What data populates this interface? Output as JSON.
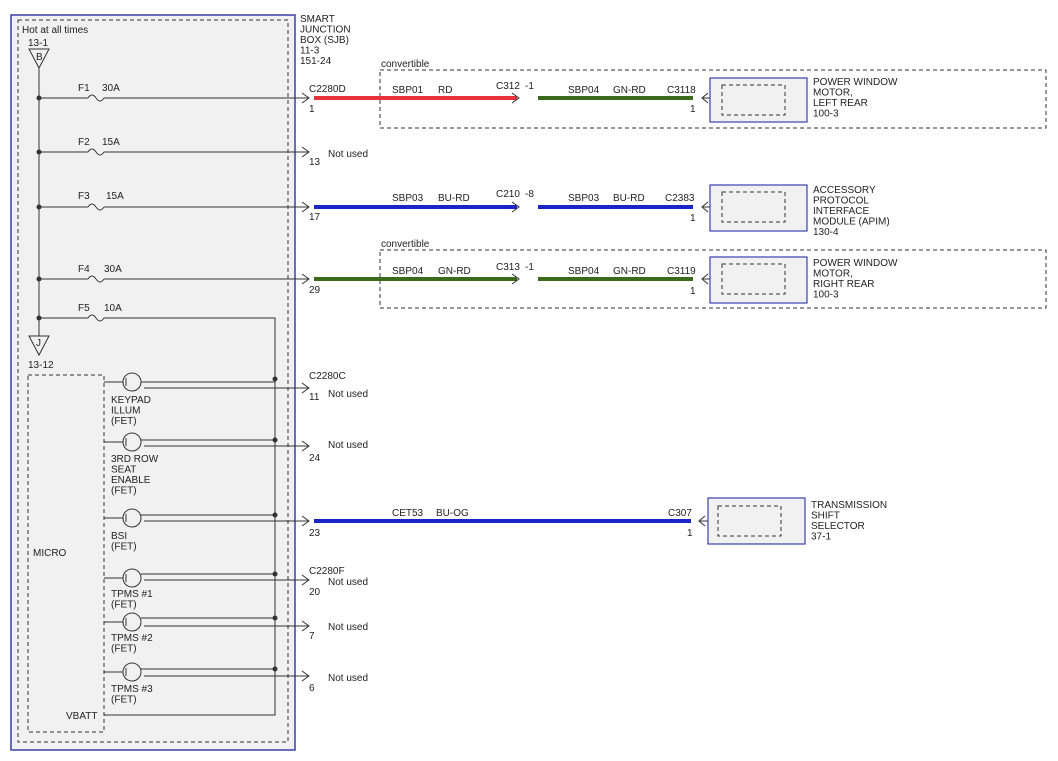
{
  "colors": {
    "RD": "#e8313a",
    "GN": "#3c6a1c",
    "BU": "#1a25c8",
    "box_fill": "#f1f1f1",
    "box_border": "#3a41a8"
  },
  "sjb": {
    "hot_label": "Hot at all times",
    "bus_in_ref": "13-1",
    "bus_in_letter": "B",
    "bus_out_letter": "J",
    "bus_out_ref": "13-12",
    "title_lines": [
      "SMART",
      "JUNCTION",
      "BOX (SJB)",
      "11-3",
      "151-24"
    ],
    "micro_label": "MICRO",
    "vbatt_label": "VBATT"
  },
  "fuses": [
    {
      "name": "F1",
      "rating": "30A"
    },
    {
      "name": "F2",
      "rating": "15A"
    },
    {
      "name": "F3",
      "rating": "15A"
    },
    {
      "name": "F4",
      "rating": "30A"
    },
    {
      "name": "F5",
      "rating": "10A"
    }
  ],
  "fets": [
    {
      "label_lines": [
        "KEYPAD",
        "ILLUM",
        "(FET)"
      ]
    },
    {
      "label_lines": [
        "3RD ROW",
        "SEAT",
        "ENABLE",
        "(FET)"
      ]
    },
    {
      "label_lines": [
        "BSI",
        "(FET)"
      ]
    },
    {
      "label_lines": [
        "TPMS #1",
        "(FET)"
      ]
    },
    {
      "label_lines": [
        "TPMS #2",
        "(FET)"
      ]
    },
    {
      "label_lines": [
        "TPMS #3",
        "(FET)"
      ]
    }
  ],
  "connector_headers": [
    "C2280D",
    "C2280C",
    "C2280F"
  ],
  "pins": [
    "1",
    "13",
    "17",
    "29",
    "11",
    "24",
    "23",
    "20",
    "7",
    "6"
  ],
  "not_used": "Not used",
  "convertible_label": "convertible",
  "circuits": [
    {
      "a": "SBP01",
      "b": "RD",
      "c": "SBP04",
      "d": "GN-RD",
      "inline": "C312",
      "inline_pin": "-1",
      "end_conn": "C3118",
      "end_pin": "1"
    },
    {
      "a": "SBP03",
      "b": "BU-RD",
      "c": "SBP03",
      "d": "BU-RD",
      "inline": "C210",
      "inline_pin": "-8",
      "end_conn": "C2383",
      "end_pin": "1"
    },
    {
      "a": "SBP04",
      "b": "GN-RD",
      "c": "SBP04",
      "d": "GN-RD",
      "inline": "C313",
      "inline_pin": "-1",
      "end_conn": "C3119",
      "end_pin": "1"
    },
    {
      "a": "CET53",
      "b": "BU-OG",
      "end_conn": "C307",
      "end_pin": "1"
    }
  ],
  "components": [
    {
      "lines": [
        "POWER WINDOW",
        "MOTOR,",
        "LEFT REAR",
        "100-3"
      ]
    },
    {
      "lines": [
        "ACCESSORY",
        "PROTOCOL",
        "INTERFACE",
        "MODULE (APIM)",
        "130-4"
      ]
    },
    {
      "lines": [
        "POWER WINDOW",
        "MOTOR,",
        "RIGHT REAR",
        "100-3"
      ]
    },
    {
      "lines": [
        "TRANSMISSION",
        "SHIFT",
        "SELECTOR",
        "37-1"
      ]
    }
  ]
}
